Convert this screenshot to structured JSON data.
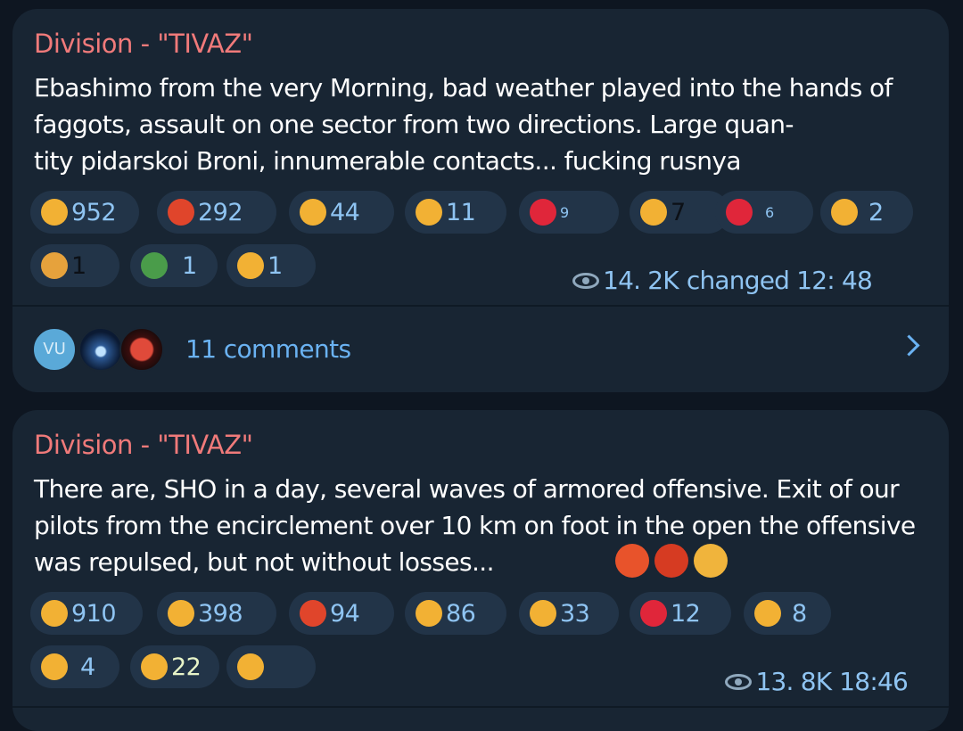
{
  "posts": [
    {
      "author": "Division - \"TIVAZ\"",
      "text_lines": [
        "Ebashimo from the very Morning, bad weather played into the hands of",
        "faggots, assault on one sector from two directions. Large quan-",
        "tity pidarskoi Broni, innumerable contacts... fucking rusnya"
      ],
      "reactions": [
        {
          "icon": "pray-icon",
          "count": "952",
          "color": "#f2b134"
        },
        {
          "icon": "cursing-face-icon",
          "count": "292",
          "color": "#e0452b"
        },
        {
          "icon": "pointing-hand-icon",
          "count": "44",
          "color": "#f2b134"
        },
        {
          "icon": "thumbs-up-icon",
          "count": "11",
          "color": "#f2b134"
        },
        {
          "icon": "broken-heart-icon",
          "count": "9",
          "color": "#e0263a"
        },
        {
          "icon": "exploding-head-icon",
          "count": "7",
          "color": "#f2b134"
        },
        {
          "icon": "red-heart-icon",
          "count": "6",
          "color": "#e0263a"
        },
        {
          "icon": "star-struck-icon",
          "count": "2",
          "color": "#f2b134"
        },
        {
          "icon": "party-popper-icon",
          "count": "1",
          "color": "#e6a23c"
        },
        {
          "icon": "champagne-icon",
          "count": "1",
          "color": "#4a9c4a"
        },
        {
          "icon": "hugging-face-icon",
          "count": "1",
          "color": "#f2b134"
        }
      ],
      "views": "14. 2K",
      "meta": "changed 12: 48",
      "comments": {
        "avatar_initials": "VU",
        "label": "11 comments"
      }
    },
    {
      "author": "Division - \"TIVAZ\"",
      "text_lines": [
        "There are, SHO in a day, several waves of armored offensive. Exit of our",
        "pilots from the encirclement over 10 km on foot in the open the offensive",
        "was repulsed, but not without losses..."
      ],
      "inline_emojis": [
        "angry-face-icon",
        "cursing-face-icon",
        "exploding-head-icon"
      ],
      "reactions": [
        {
          "icon": "pray-icon",
          "count": "910",
          "color": "#f2b134"
        },
        {
          "icon": "crying-face-icon",
          "count": "398",
          "color": "#f2b134"
        },
        {
          "icon": "cursing-face-icon",
          "count": "94",
          "color": "#e0452b"
        },
        {
          "icon": "pointing-hand-icon",
          "count": "86",
          "color": "#f2b134"
        },
        {
          "icon": "sad-face-icon",
          "count": "33",
          "color": "#f2b134"
        },
        {
          "icon": "broken-heart-icon",
          "count": "12",
          "color": "#e0263a"
        },
        {
          "icon": "screaming-face-icon",
          "count": "8",
          "color": "#f2b134"
        },
        {
          "icon": "exploding-head-icon",
          "count": "4",
          "color": "#f2b134"
        },
        {
          "icon": "thumbs-up-icon",
          "count": "22",
          "color": "#f2b134"
        },
        {
          "icon": "star-struck-icon",
          "count": "",
          "color": "#f2b134"
        }
      ],
      "views": "13. 8K",
      "meta": "18:46"
    }
  ]
}
